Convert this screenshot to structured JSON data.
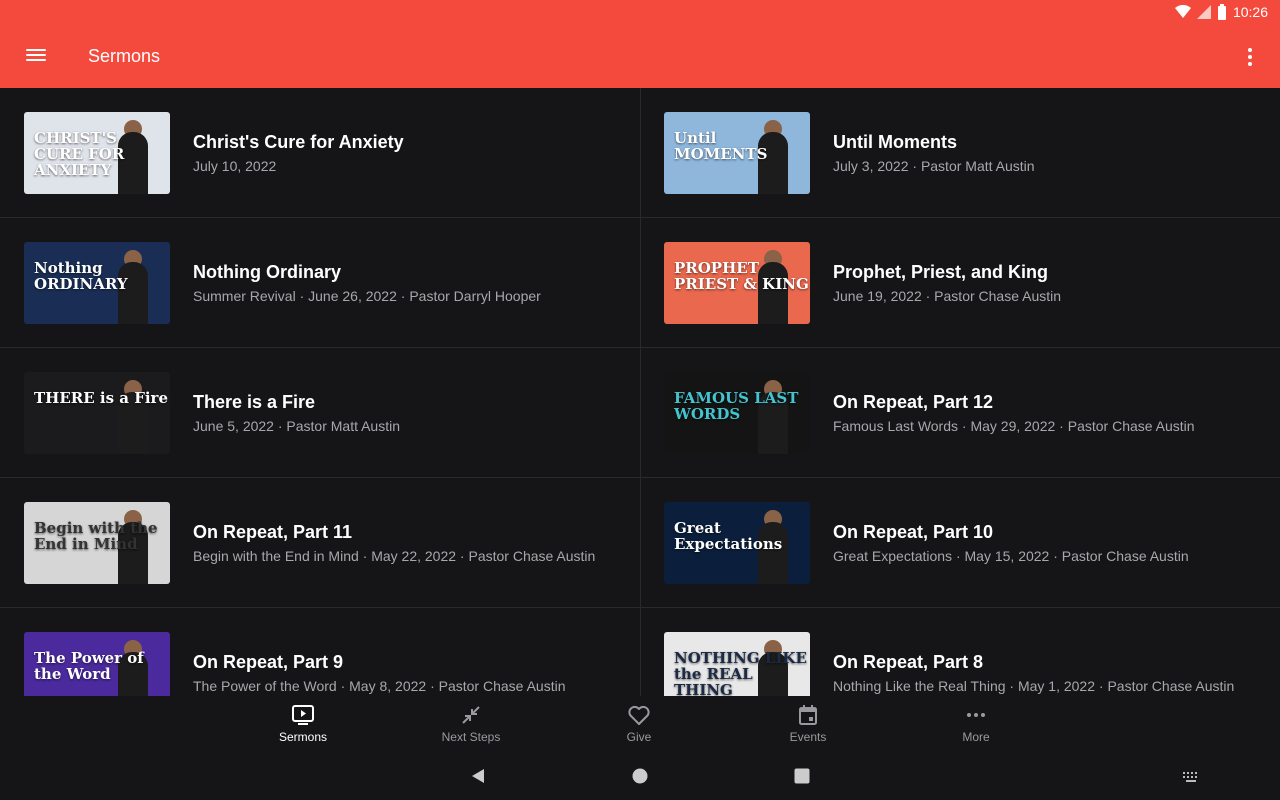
{
  "status": {
    "time": "10:26"
  },
  "appbar": {
    "title": "Sermons"
  },
  "sermons": [
    {
      "title": "Christ's Cure for Anxiety",
      "subtitle": "July 10, 2022",
      "thumb_text": "CHRIST'S CURE FOR ANXIETY",
      "thumb_bg": "#dfe3ea",
      "thumb_fg": "#ffffff"
    },
    {
      "title": "Until Moments",
      "subtitle": "July 3, 2022 · Pastor Matt Austin",
      "thumb_text": "Until MOMENTS",
      "thumb_bg": "#8fb7dc",
      "thumb_fg": "#ffffff"
    },
    {
      "title": "Nothing Ordinary",
      "subtitle": "Summer Revival · June 26, 2022 · Pastor Darryl Hooper",
      "thumb_text": "Nothing ORDINARY",
      "thumb_bg": "#1a2e55",
      "thumb_fg": "#ffffff"
    },
    {
      "title": "Prophet, Priest, and King",
      "subtitle": "June 19, 2022 · Pastor Chase Austin",
      "thumb_text": "PROPHET PRIEST & KING",
      "thumb_bg": "#e9684e",
      "thumb_fg": "#ffffff"
    },
    {
      "title": "There is a Fire",
      "subtitle": "June 5, 2022 · Pastor Matt Austin",
      "thumb_text": "THERE is a Fire",
      "thumb_bg": "#1b1b1d",
      "thumb_fg": "#ffffff"
    },
    {
      "title": "On Repeat, Part 12",
      "subtitle": "Famous Last Words · May 29, 2022 · Pastor Chase Austin",
      "thumb_text": "FAMOUS LAST WORDS",
      "thumb_bg": "#141414",
      "thumb_fg": "#43c4cf"
    },
    {
      "title": "On Repeat, Part 11",
      "subtitle": "Begin with the End in Mind · May 22, 2022 · Pastor Chase Austin",
      "thumb_text": "Begin with the End in Mind",
      "thumb_bg": "#d6d6d6",
      "thumb_fg": "#333333"
    },
    {
      "title": "On Repeat, Part 10",
      "subtitle": "Great Expectations · May 15, 2022 · Pastor Chase Austin",
      "thumb_text": "Great Expectations",
      "thumb_bg": "#0b1f3c",
      "thumb_fg": "#ffffff"
    },
    {
      "title": "On Repeat, Part 9",
      "subtitle": "The Power of the Word · May 8, 2022 · Pastor Chase Austin",
      "thumb_text": "The Power of the Word",
      "thumb_bg": "#4a2a9c",
      "thumb_fg": "#ffffff"
    },
    {
      "title": "On Repeat, Part 8",
      "subtitle": "Nothing Like the Real Thing · May 1, 2022 · Pastor Chase Austin",
      "thumb_text": "NOTHING LIKE the REAL THING",
      "thumb_bg": "#e8e8e8",
      "thumb_fg": "#1c2a44"
    }
  ],
  "bottom_nav": [
    {
      "label": "Sermons",
      "icon": "tv-play-icon",
      "active": true
    },
    {
      "label": "Next Steps",
      "icon": "arrows-in-icon",
      "active": false
    },
    {
      "label": "Give",
      "icon": "heart-icon",
      "active": false
    },
    {
      "label": "Events",
      "icon": "calendar-icon",
      "active": false
    },
    {
      "label": "More",
      "icon": "more-dots-icon",
      "active": false
    }
  ],
  "colors": {
    "accent": "#f44a3e",
    "background": "#151518",
    "divider": "#2a2a2e",
    "subtitle": "#a8a8ac"
  }
}
